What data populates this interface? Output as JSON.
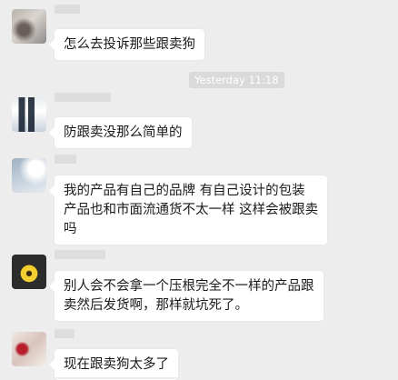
{
  "timestamp": "Yesterday 11:18",
  "messages": [
    {
      "text": "怎么去投诉那些跟卖狗"
    },
    {
      "text": "防跟卖没那么简单的"
    },
    {
      "text": "我的产品有自己的品牌  有自己设计的包装\n产品也和市面流通货不太一样  这样会被跟卖\n吗"
    },
    {
      "text": "别人会不会拿一个压根完全不一样的产品跟\n卖然后发货啊，那样就坑死了。"
    },
    {
      "text": "现在跟卖狗太多了"
    }
  ],
  "colors": {
    "background": "#ededed",
    "bubble": "#ffffff",
    "timestamp_pill": "#dadada"
  }
}
